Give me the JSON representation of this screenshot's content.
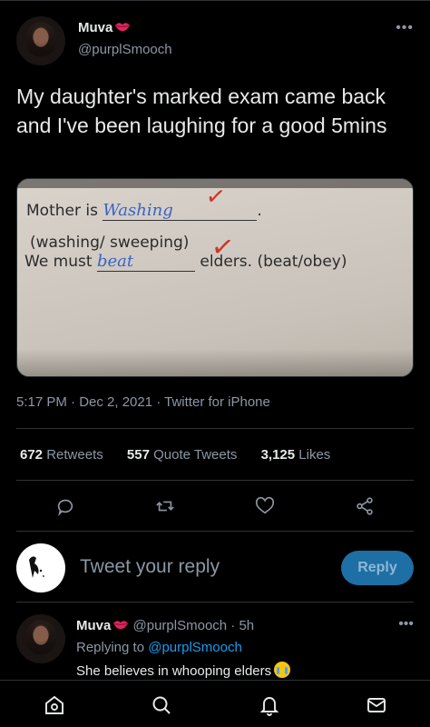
{
  "tweet": {
    "author_name": "Muva",
    "author_emoji": "lips-kiss-icon",
    "handle": "@purplSmooch",
    "text": "My daughter's marked exam came back and I've been laughing for a good 5mins",
    "timestamp": "5:17 PM · Dec 2, 2021 · Twitter for iPhone"
  },
  "exam_image": {
    "line1_prefix": "Mother is",
    "line1_answer": "Washing",
    "line2": "(washing/ sweeping)",
    "line3_prefix": "We must",
    "line3_answer": "beat",
    "line3_suffix": "elders. (beat/obey)"
  },
  "stats": {
    "retweets_count": "672",
    "retweets_label": "Retweets",
    "quotes_count": "557",
    "quotes_label": "Quote Tweets",
    "likes_count": "3,125",
    "likes_label": "Likes"
  },
  "actions": [
    "reply-icon",
    "retweet-icon",
    "like-icon",
    "share-icon"
  ],
  "composer": {
    "placeholder": "Tweet your reply",
    "button_label": "Reply"
  },
  "reply": {
    "author_name": "Muva",
    "handle": "@purplSmooch",
    "time": "· 5h",
    "replying_prefix": "Replying to",
    "replying_handle": "@purplSmooch",
    "text": "She believes in whooping elders"
  },
  "bottom_nav": [
    "home-icon",
    "search-icon",
    "notifications-icon",
    "messages-icon"
  ],
  "colors": {
    "background": "#000000",
    "accent": "#1d9bf0",
    "reply_button": "#1d6fa5",
    "muted_text": "#8b98a5"
  }
}
